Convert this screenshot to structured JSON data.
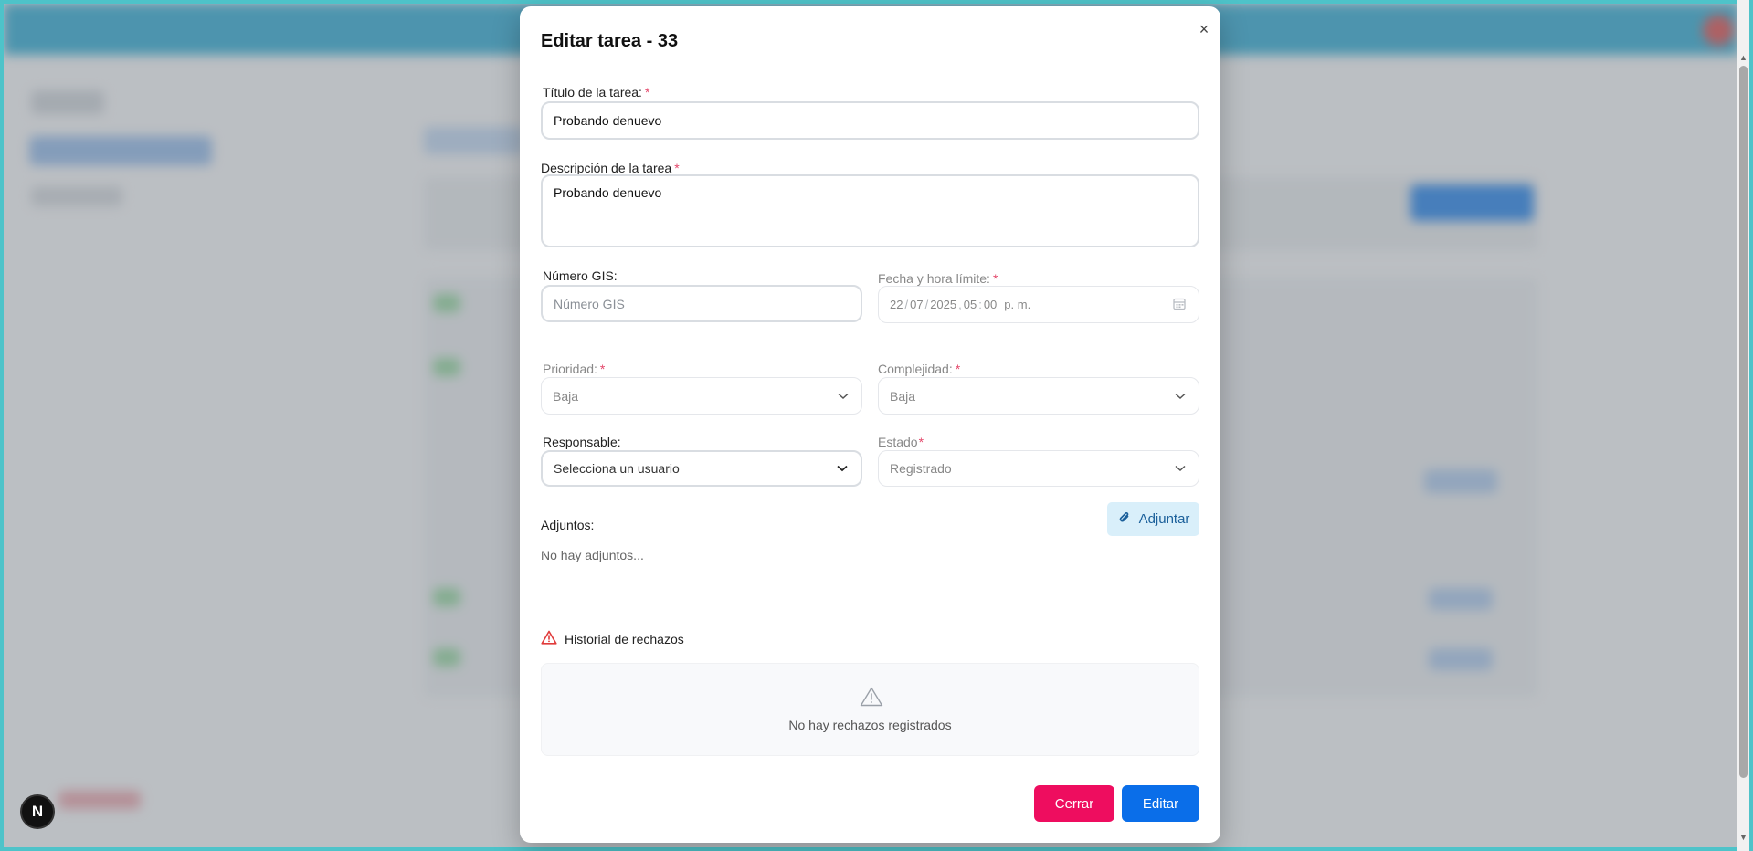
{
  "modal": {
    "title": "Editar tarea - 33",
    "close_icon": "×",
    "required_mark": "*",
    "fields": {
      "title": {
        "label": "Título de la tarea:",
        "value": "Probando denuevo"
      },
      "description": {
        "label": "Descripción de la tarea",
        "value": "Probando denuevo"
      },
      "gis": {
        "label": "Número GIS:",
        "placeholder": "Número GIS"
      },
      "deadline": {
        "label": "Fecha y hora límite:",
        "day": "22",
        "month": "07",
        "year": "2025",
        "hour": "05",
        "minute": "00",
        "ampm": "p. m."
      },
      "priority": {
        "label": "Prioridad:",
        "value": "Baja"
      },
      "complexity": {
        "label": "Complejidad:",
        "value": "Baja"
      },
      "assignee": {
        "label": "Responsable:",
        "value": "Selecciona un usuario"
      },
      "status": {
        "label": "Estado",
        "value": "Registrado"
      }
    },
    "attachments": {
      "label": "Adjuntos:",
      "button_label": "Adjuntar",
      "empty_text": "No hay adjuntos..."
    },
    "rejections": {
      "title": "Historial de rechazos",
      "empty_text": "No hay rechazos registrados"
    },
    "buttons": {
      "close": "Cerrar",
      "edit": "Editar"
    }
  },
  "dev_badge": {
    "letter": "N"
  },
  "colors": {
    "accent_blue": "#0a6ee9",
    "danger_pink": "#ee0d5f",
    "required_red": "#e4476a",
    "attach_bg": "#d9effa",
    "warning_red": "#e03b3b"
  }
}
